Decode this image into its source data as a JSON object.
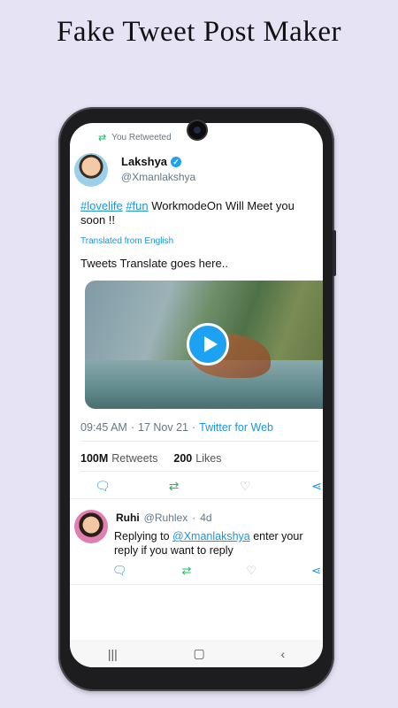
{
  "headline": "Fake Tweet Post Maker",
  "tweet": {
    "retweet_label": "You Retweeted",
    "name": "Lakshya",
    "handle": "@Xmanlakshya",
    "hashtag1": "#lovelife",
    "hashtag2": "#fun",
    "text_line": " WorkmodeOn Will Meet you soon !!",
    "translated_label": "Translated from English",
    "translation": "Tweets Translate goes here..",
    "time": "09:45 AM",
    "date": "17 Nov 21",
    "separator": "·",
    "source": "Twitter for Web",
    "retweets_count": "100M",
    "retweets_label": "Retweets",
    "likes_count": "200",
    "likes_label": "Likes"
  },
  "reply": {
    "name": "Ruhi",
    "handle": "@Ruhlex",
    "separator": "·",
    "age": "4d",
    "prefix": "Replying to ",
    "mention": "@Xmanlakshya",
    "text": " enter your reply if you want to reply"
  },
  "icons": {
    "retweet": "retweet-icon",
    "verified": "verified-badge-icon",
    "reply": "reply-icon",
    "like": "heart-icon",
    "share": "share-icon",
    "play": "play-icon",
    "nav_recents": "recents-icon",
    "nav_home": "home-icon",
    "nav_back": "back-icon"
  },
  "colors": {
    "background": "#e6e3f5",
    "link": "#1b95e0",
    "retweet_green": "#17bf63",
    "verified_blue": "#1da1f2"
  }
}
